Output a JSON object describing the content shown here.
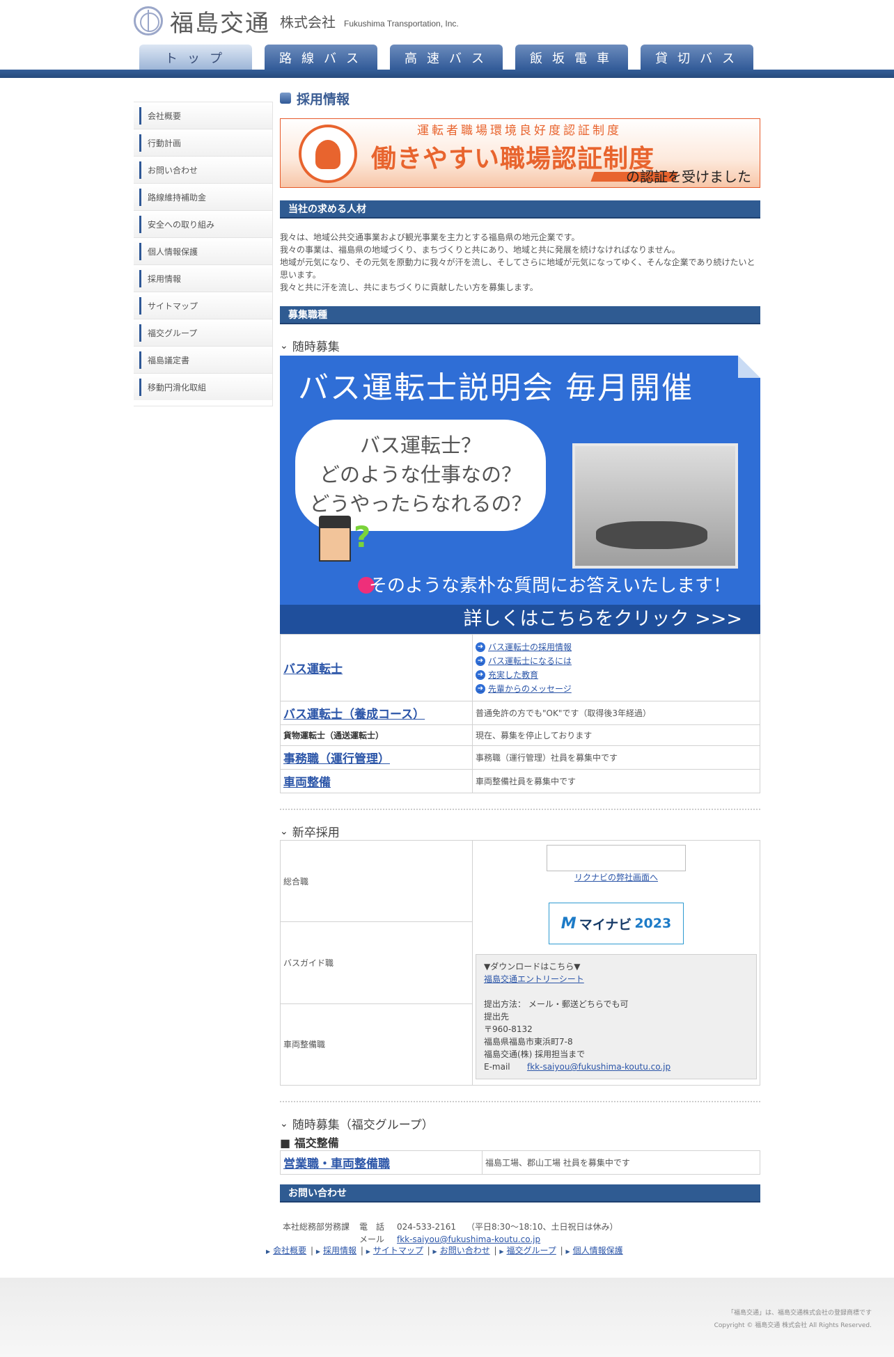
{
  "header": {
    "logo_name": "福島交通",
    "logo_kk": "株式会社",
    "logo_en": "Fukushima Transportation, Inc.",
    "nav": [
      "トップ",
      "路線バス",
      "高速バス",
      "飯坂電車",
      "貸切バス"
    ]
  },
  "sidebar": {
    "items": [
      "会社概要",
      "行動計画",
      "お問い合わせ",
      "路線維持補助金",
      "安全への取り組み",
      "個人情報保護",
      "採用情報",
      "サイトマップ",
      "福交グループ",
      "福島議定書",
      "移動円滑化取組"
    ]
  },
  "main": {
    "page_title": "採用情報",
    "banner1": {
      "sub": "運転者職場環境良好度認証制度",
      "main": "働きやすい職場認証制度",
      "tail": "の認証を受けました"
    },
    "section_people": "当社の求める人材",
    "intro": [
      "我々は、地域公共交通事業および観光事業を主力とする福島県の地元企業です。",
      "我々の事業は、福島県の地域づくり、まちづくりと共にあり、地域と共に発展を続けなければなりません。",
      "地域が元気になり、その元気を原動力に我々が汗を流し、そしてさらに地域が元気になってゆく、そんな企業であり続けたいと思います。",
      "我々と共に汗を流し、共にまちづくりに貢献したい方を募集します。"
    ],
    "section_jobs": "募集職種",
    "ongoing_head": "随時募集",
    "banner2": {
      "title": "バス運転士説明会 毎月開催",
      "bubble": [
        "バス運転士？",
        "どのような仕事なの？",
        "どうやったらなれるの？"
      ],
      "answer": "そのような素朴な質問にお答えいたします！",
      "click": "詳しくはこちらをクリック >>>"
    },
    "jobs": [
      {
        "name": "バス運転士",
        "links": [
          "バス運転士の採用情報",
          "バス運転士になるには",
          "充実した教育",
          "先輩からのメッセージ"
        ]
      },
      {
        "name": "バス運転士（養成コース）",
        "desc": "普通免許の方でも\"OK\"です（取得後3年経過）"
      },
      {
        "name": "貨物運転士（通送運転士）",
        "desc": "現在、募集を停止しております"
      },
      {
        "name": "事務職（運行管理）",
        "desc": "事務職（運行管理）社員を募集中です"
      },
      {
        "name": "車両整備",
        "desc": "車両整備社員を募集中です"
      }
    ],
    "grad_head": "新卒採用",
    "grad_rows": [
      "総合職",
      "バスガイド職",
      "車両整備職"
    ],
    "rikunabi_link": "リクナビの弊社画面へ",
    "mynavi": {
      "brand": "マイナビ",
      "year": "2023"
    },
    "download": {
      "head": "▼ダウンロードはこちら▼",
      "link": "福島交通エントリーシート",
      "method": "提出方法： メール・郵送どちらでも可",
      "dest_label": "提出先",
      "zip": "〒960-8132",
      "address": "福島県福島市東浜町7-8",
      "company": "福島交通(株) 採用担当まで",
      "email_label": "E-mail",
      "email": "fkk-saiyou@fukushima-koutu.co.jp"
    },
    "group_recruit_head": "随時募集（福交グループ）",
    "group_name": "■ 福交整備",
    "group_job": {
      "name": "営業職・車両整備職",
      "desc": "福島工場、郡山工場 社員を募集中です"
    },
    "section_contact": "お問い合わせ",
    "contact": {
      "dept": "本社総務部労務課",
      "tel_label": "電　話",
      "tel": "024-533-2161",
      "hours": "（平日8:30～18:10、土日祝日は休み）",
      "mail_label": "メール",
      "mail": "fkk-saiyou@fukushima-koutu.co.jp"
    }
  },
  "footer": {
    "links": [
      "会社概要",
      "採用情報",
      "サイトマップ",
      "お問い合わせ",
      "福交グループ",
      "個人情報保護"
    ],
    "trademark": "「福島交通」は、福島交通株式会社の登録商標です",
    "copyright": "Copyright © 福島交通 株式会社 All Rights Reserved."
  }
}
